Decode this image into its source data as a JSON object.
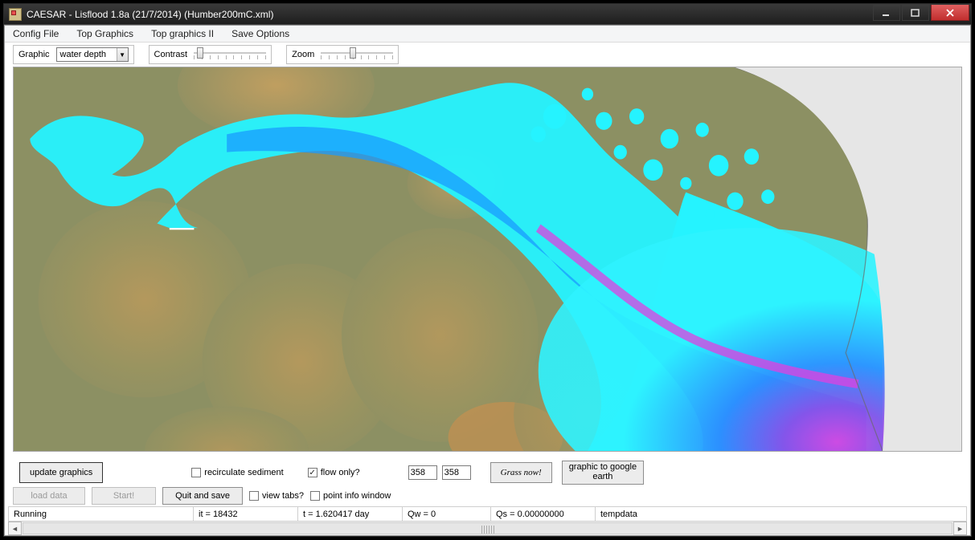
{
  "window": {
    "title": "CAESAR - Lisflood 1.8a (21/7/2014) (Humber200mC.xml)"
  },
  "menubar": {
    "config_file": "Config File",
    "top_graphics": "Top Graphics",
    "top_graphics2": "Top graphics II",
    "save_options": "Save Options"
  },
  "toolbar": {
    "graphic_label": "Graphic",
    "graphic_value": "water depth",
    "contrast_label": "Contrast",
    "zoom_label": "Zoom"
  },
  "bottom": {
    "update_graphics": "update graphics",
    "recirculate_sediment": "recirculate sediment",
    "flow_only": "flow only?",
    "num1": "358",
    "num2": "358",
    "grass_now": "Grass now!",
    "graphic_google_earth_l1": "graphic to google",
    "graphic_google_earth_l2": "earth",
    "load_data": "load data",
    "start": "Start!",
    "quit_save": "Quit and save",
    "view_tabs": "view tabs?",
    "point_info": "point info window"
  },
  "status": {
    "running": "Running",
    "it": "it = 18432",
    "t": "t = 1.620417 day",
    "qw": "Qw = 0",
    "qs": "Qs = 0.00000000",
    "tempdata": "tempdata"
  }
}
